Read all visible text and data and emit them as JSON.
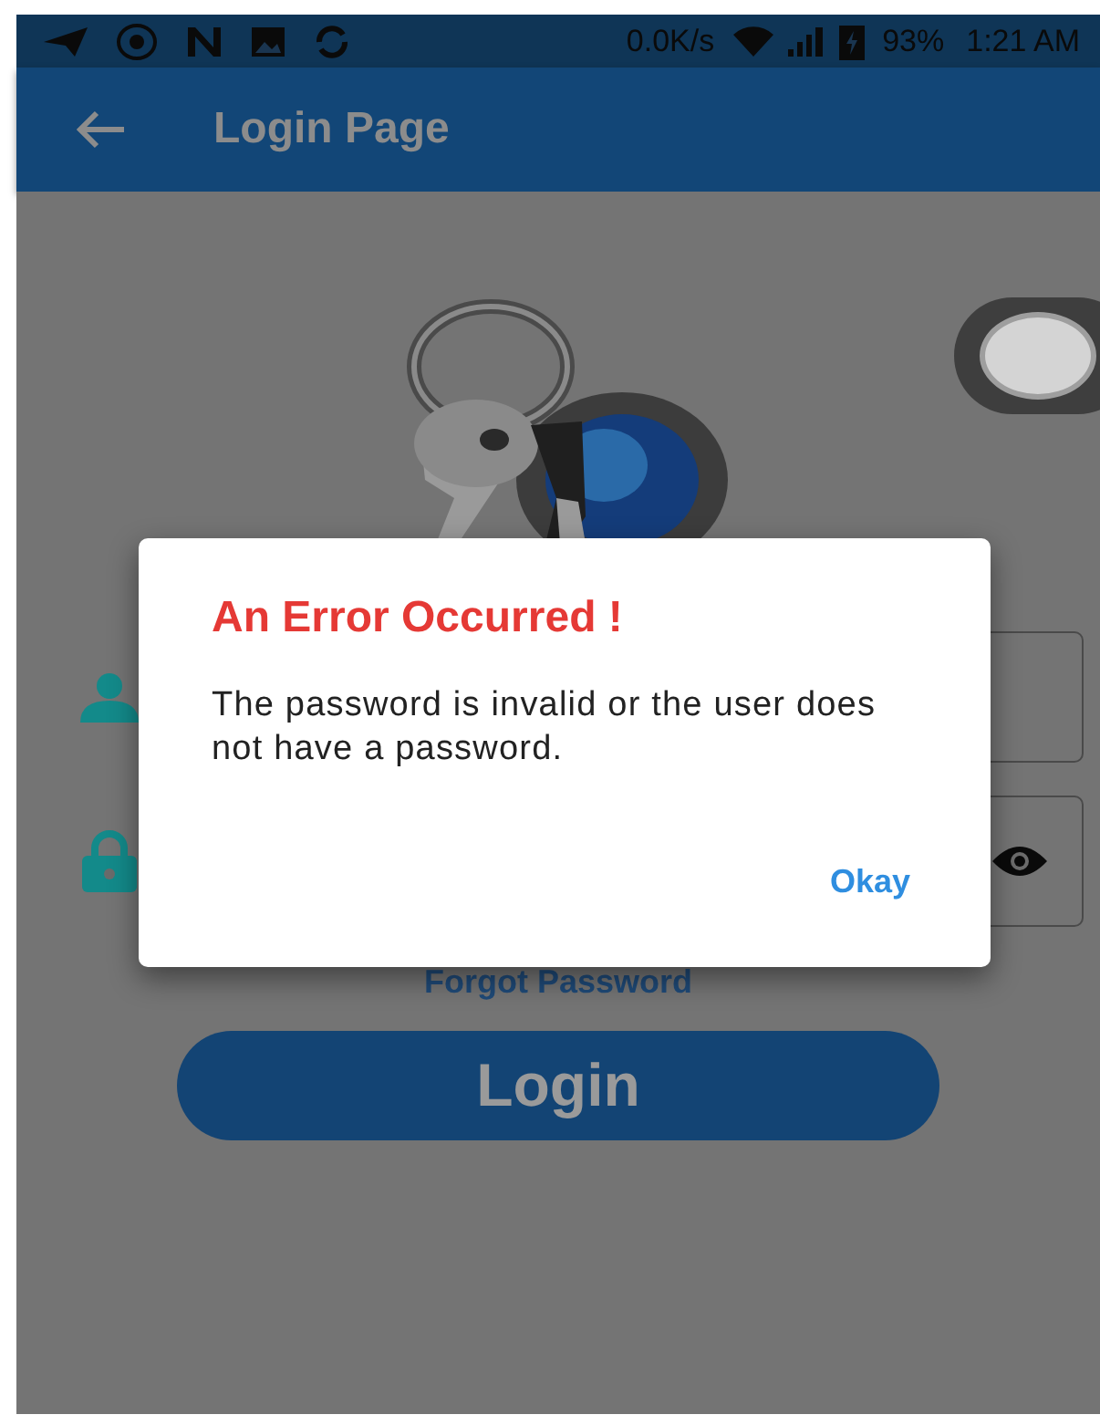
{
  "status_bar": {
    "network_speed": "0.0K/s",
    "battery": "93%",
    "time": "1:21 AM"
  },
  "app_bar": {
    "title": "Login Page"
  },
  "toggle": {
    "on": false
  },
  "form": {
    "forgot_password": "Forgot Password",
    "login_button": "Login"
  },
  "dialog": {
    "title": "An Error Occurred !",
    "message": "The password is invalid or the user does not have a password.",
    "button": "Okay"
  }
}
